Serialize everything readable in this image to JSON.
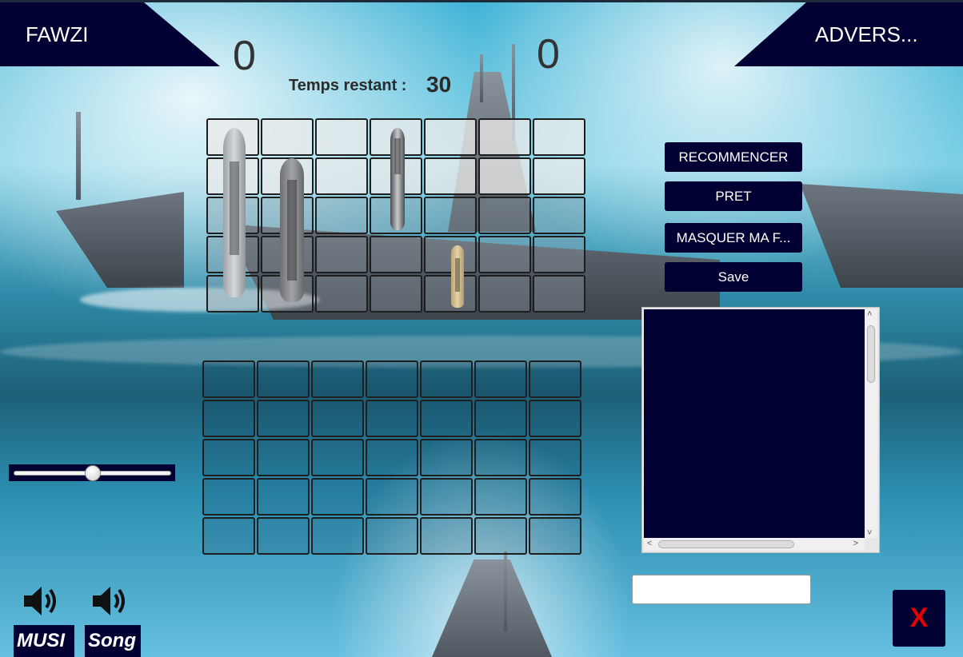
{
  "players": {
    "left_name": "FAWZI",
    "right_name": "ADVERS..."
  },
  "scores": {
    "left": "0",
    "right": "0"
  },
  "timer": {
    "label": "Temps restant :",
    "value": "30"
  },
  "buttons": {
    "restart": "RECOMMENCER",
    "ready": "PRET",
    "hide_fleet": "MASQUER MA F...",
    "save": "Save",
    "close": "X"
  },
  "chat": {
    "input_value": "",
    "input_placeholder": ""
  },
  "volume": {
    "level_fraction": 0.5
  },
  "sound_controls": {
    "music_label": "MUSI",
    "song_label": "Song"
  },
  "colors": {
    "panel": "#000033",
    "close_x": "#e30000",
    "timer_text": "#2b2b2b"
  },
  "icons": {
    "music": "speaker-icon",
    "song": "speaker-icon"
  }
}
